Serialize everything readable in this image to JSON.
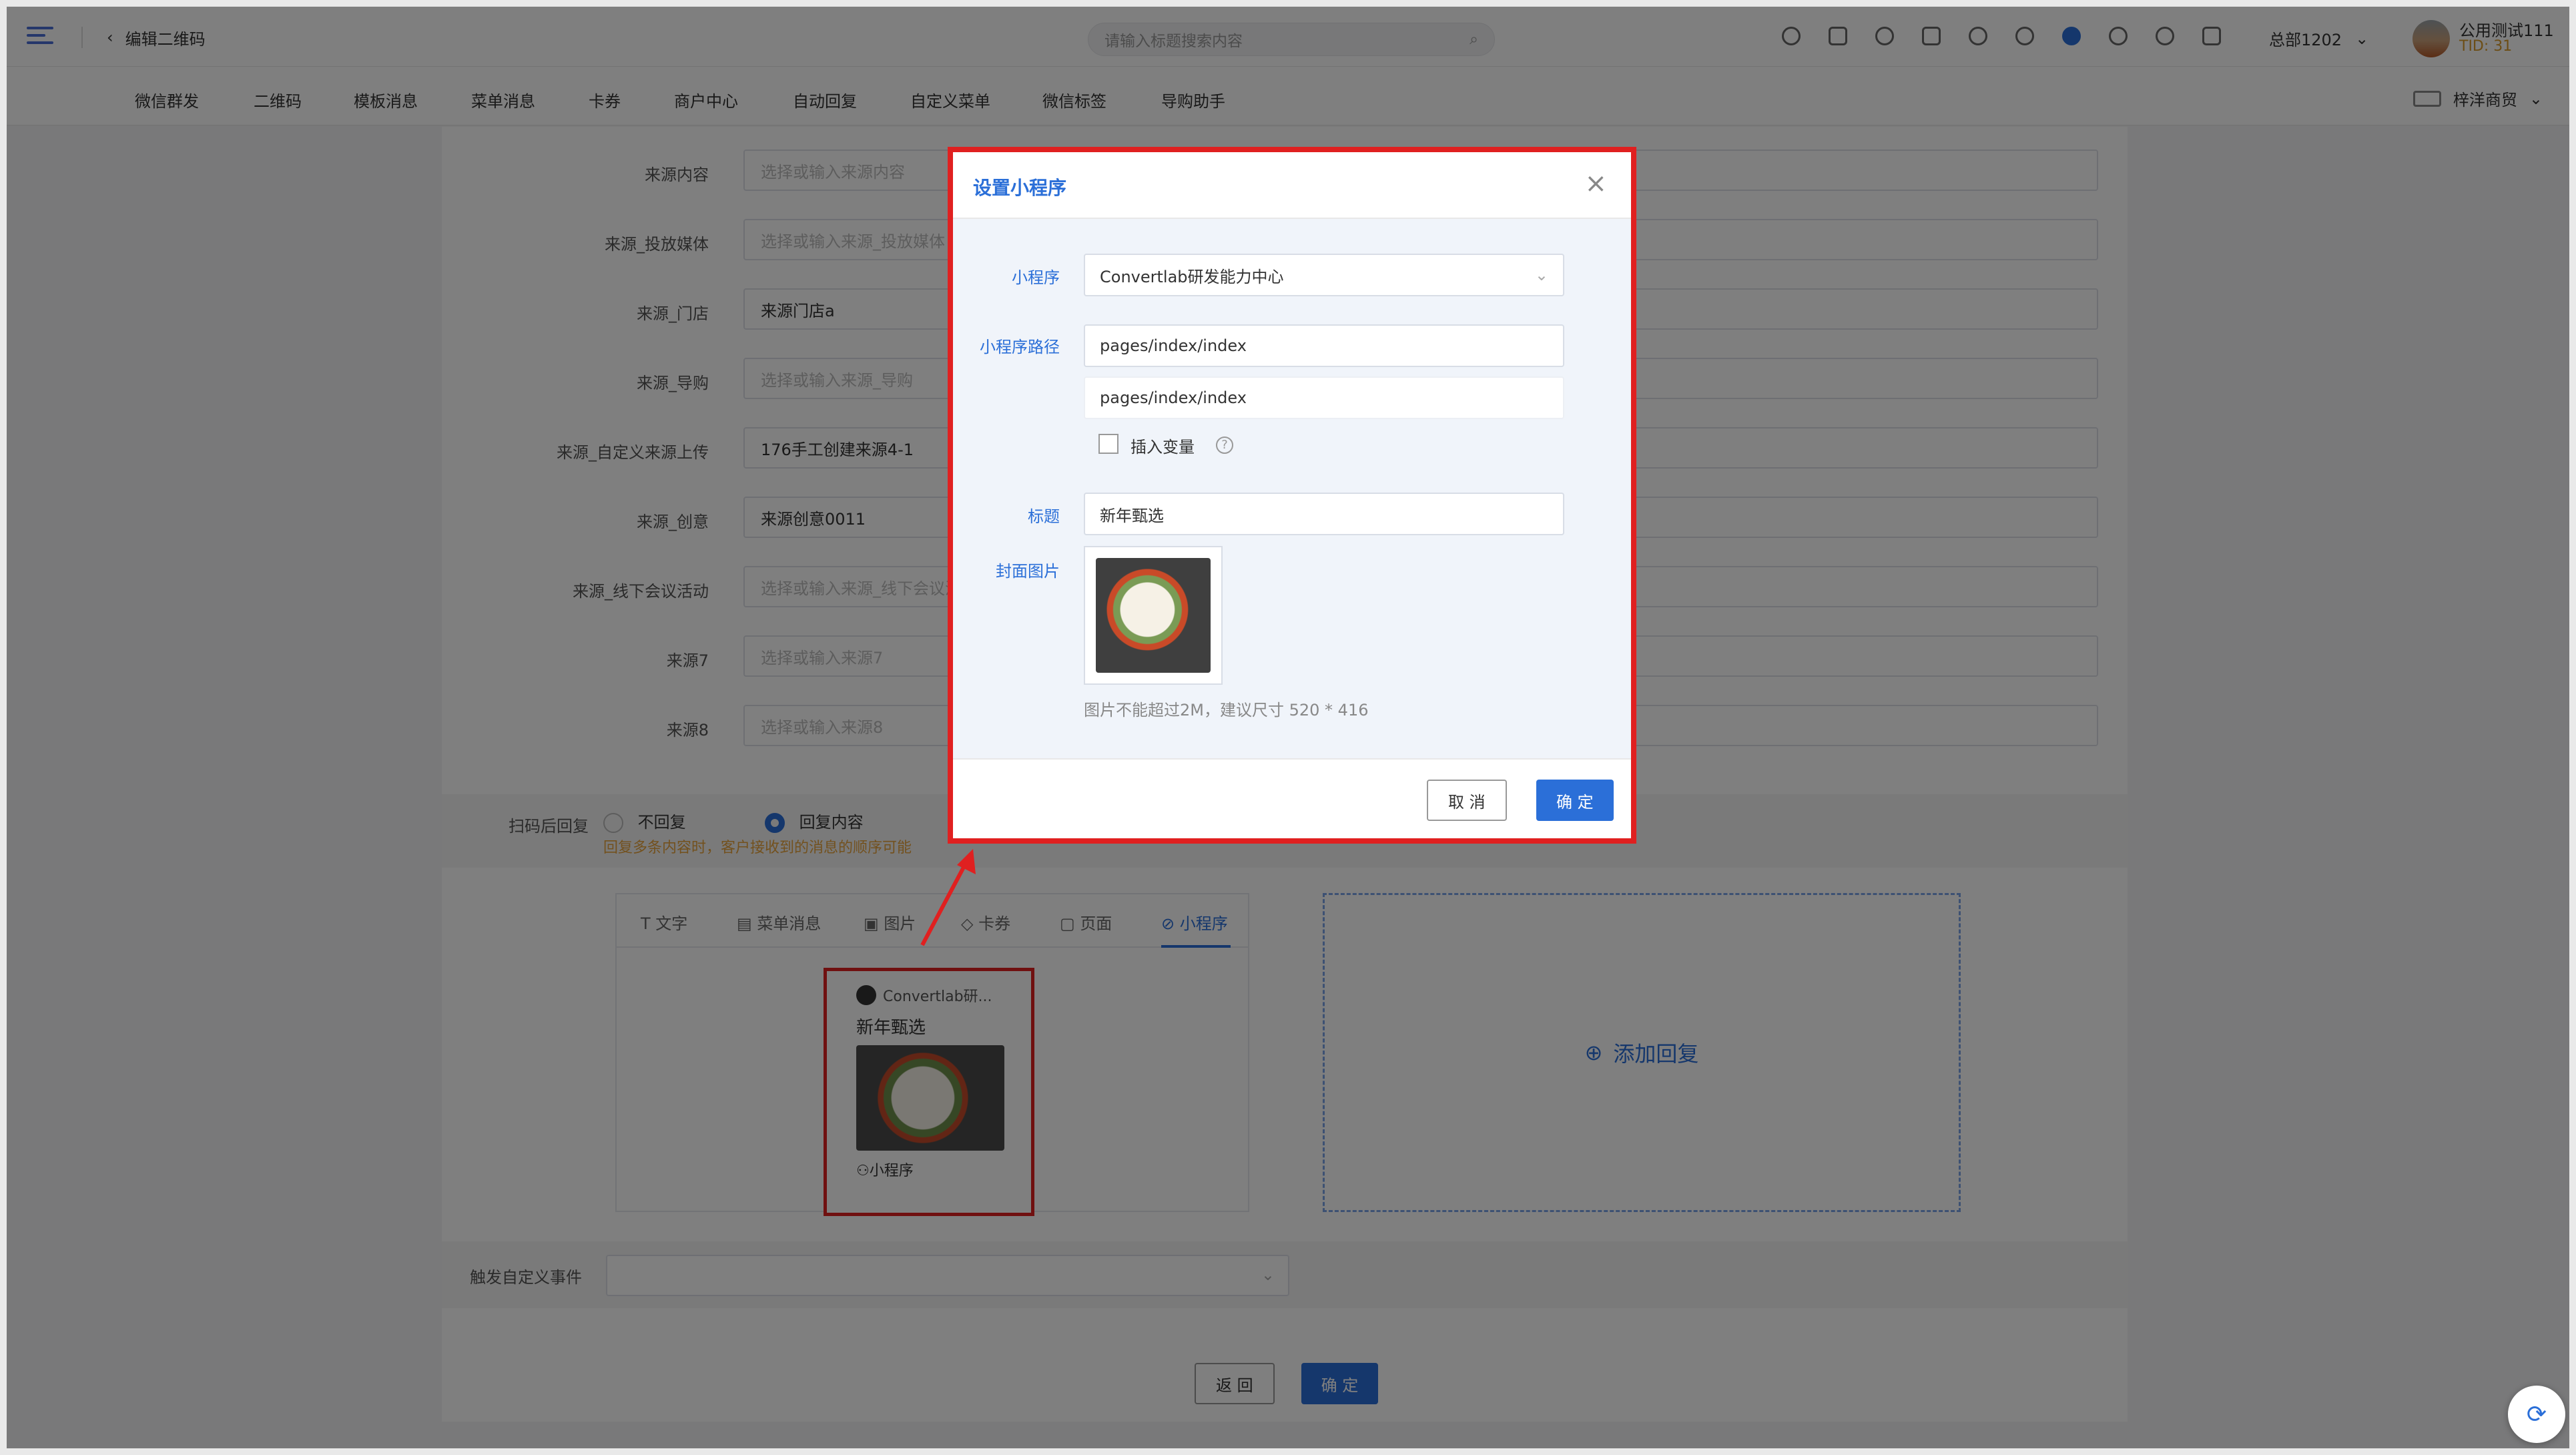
{
  "header": {
    "back_label": "编辑二维码",
    "search_placeholder": "请输入标题搜索内容",
    "org": "总部1202",
    "user_name": "公用测试111",
    "user_tid": "TID: 31"
  },
  "nav": {
    "items": [
      "微信群发",
      "二维码",
      "模板消息",
      "菜单消息",
      "卡券",
      "商户中心",
      "自动回复",
      "自定义菜单",
      "微信标签",
      "导购助手"
    ],
    "store": "梓洋商贸"
  },
  "form": {
    "rows": [
      {
        "label": "来源内容",
        "value": "",
        "placeholder": "选择或输入来源内容"
      },
      {
        "label": "来源_投放媒体",
        "value": "",
        "placeholder": "选择或输入来源_投放媒体"
      },
      {
        "label": "来源_门店",
        "value": "来源门店a",
        "placeholder": ""
      },
      {
        "label": "来源_导购",
        "value": "",
        "placeholder": "选择或输入来源_导购"
      },
      {
        "label": "来源_自定义来源上传",
        "value": "176手工创建来源4-1",
        "placeholder": ""
      },
      {
        "label": "来源_创意",
        "value": "来源创意0011",
        "placeholder": ""
      },
      {
        "label": "来源_线下会议活动",
        "value": "",
        "placeholder": "选择或输入来源_线下会议活动"
      },
      {
        "label": "来源7",
        "value": "",
        "placeholder": "选择或输入来源7"
      },
      {
        "label": "来源8",
        "value": "",
        "placeholder": "选择或输入来源8"
      }
    ],
    "reply_label": "扫码后回复",
    "reply_options": [
      "不回复",
      "回复内容"
    ],
    "reply_tip": "回复多条内容时，客户接收到的消息的顺序可能",
    "editor_tabs": [
      "文字",
      "菜单消息",
      "图片",
      "卡券",
      "页面",
      "小程序"
    ],
    "card": {
      "app_name": "Convertlab研...",
      "title": "新年甄选",
      "footer": "小程序"
    },
    "add_reply": "添加回复",
    "event_label": "触发自定义事件",
    "back_button": "返 回",
    "confirm_button": "确 定"
  },
  "modal": {
    "title": "设置小程序",
    "close": "×",
    "miniprogram_label": "小程序",
    "miniprogram_value": "Convertlab研发能力中心",
    "path_label": "小程序路径",
    "path_value": "pages/index/index",
    "path_preview": "pages/index/index",
    "insert_var_label": "插入变量",
    "title_label": "标题",
    "title_value": "新年甄选",
    "cover_label": "封面图片",
    "hint": "图片不能超过2M，建议尺寸 520 * 416",
    "cancel": "取 消",
    "ok": "确 定"
  },
  "colors": {
    "accent": "#2b6fd8",
    "highlight": "#e02020",
    "warning": "#e6a23c"
  }
}
